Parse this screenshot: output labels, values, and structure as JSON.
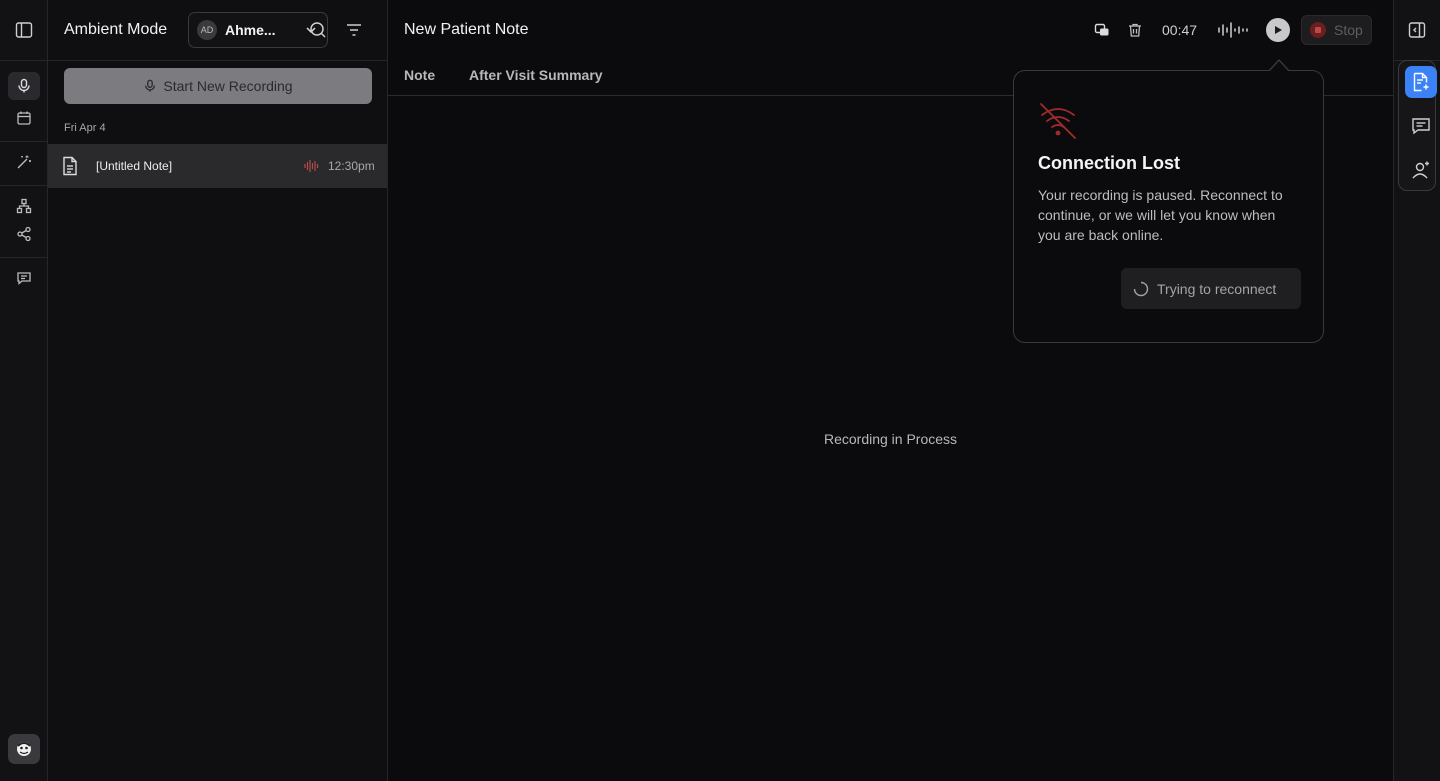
{
  "rail": {
    "items": [
      {
        "name": "sidebar-toggle-icon"
      },
      {
        "name": "microphone-icon"
      },
      {
        "name": "calendar-icon"
      },
      {
        "name": "magic-wand-icon"
      },
      {
        "name": "hierarchy-icon"
      },
      {
        "name": "share-icon"
      },
      {
        "name": "message-icon"
      }
    ]
  },
  "sidebar": {
    "title": "Ambient Mode",
    "user": {
      "initials": "AD",
      "name": "Ahme..."
    },
    "start_recording_label": "Start New Recording",
    "groups": [
      {
        "date": "Fri Apr 4",
        "notes": [
          {
            "title": "[Untitled Note]",
            "time": "12:30pm"
          }
        ]
      }
    ]
  },
  "main": {
    "title": "New Patient Note",
    "tabs": [
      {
        "label": "Note"
      },
      {
        "label": "After Visit Summary"
      }
    ],
    "timer": "00:47",
    "stop_label": "Stop",
    "center_message": "Recording in Process"
  },
  "popover": {
    "title": "Connection Lost",
    "body": "Your recording is paused. Reconnect to continue, or we will let you know when you are back online.",
    "button_label": "Trying to reconnect"
  },
  "colors": {
    "accent": "#3b82f6",
    "danger": "#b94a4a",
    "background": "#0b0b0d"
  }
}
